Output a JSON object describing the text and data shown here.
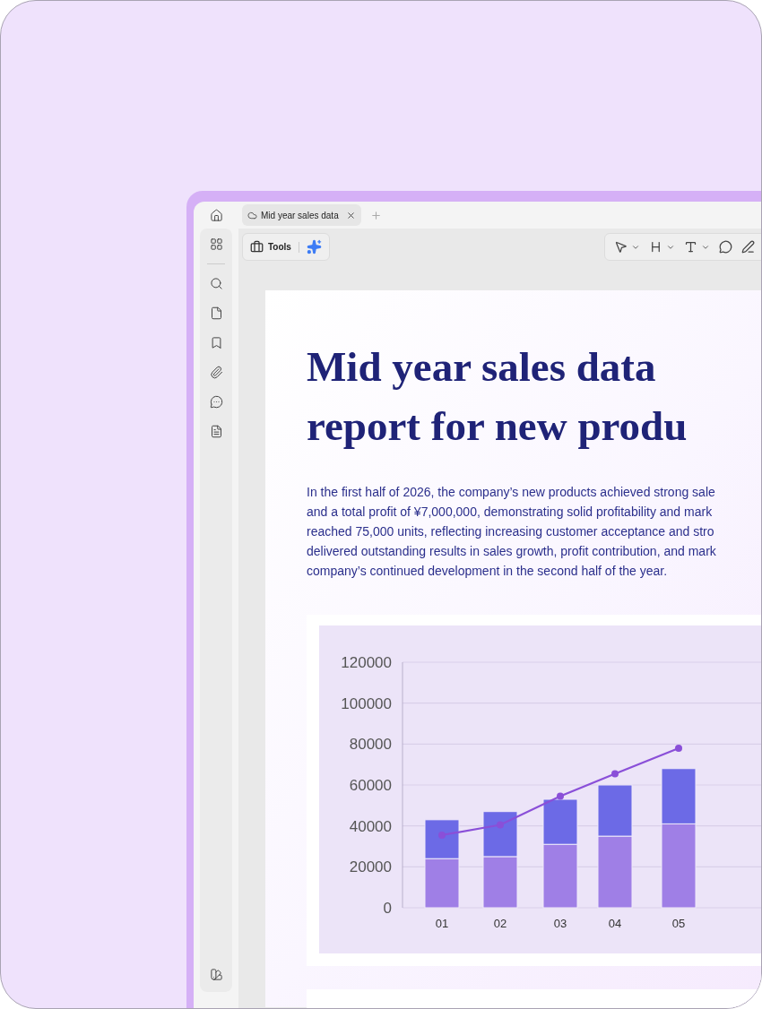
{
  "tabs": [
    {
      "label": "Mid year sales data",
      "selected": true
    }
  ],
  "toolbar": {
    "tools_label": "Tools"
  },
  "document": {
    "title_lines": [
      "Mid year sales data",
      "report for new produ"
    ],
    "paragraph_lines": [
      "In the first half of 2026, the company’s new products achieved strong sale",
      "and a total profit of ¥7,000,000, demonstrating solid profitability and mark",
      "reached 75,000 units, reflecting increasing customer acceptance and stro",
      "delivered outstanding results in sales growth, profit contribution, and mark",
      "company’s continued development in the second half of the year."
    ],
    "chart_data": {
      "type": "bar",
      "stacked": true,
      "categories": [
        "01",
        "02",
        "03",
        "04",
        "05"
      ],
      "series": [
        {
          "color": "#9f7fe6",
          "values": [
            24000,
            25000,
            31000,
            35000,
            41000
          ]
        },
        {
          "color": "#6c6ae6",
          "values": [
            19000,
            22000,
            22000,
            25000,
            27000
          ]
        },
        {
          "type": "line",
          "marker": true,
          "color": "#8a4fd8",
          "values": [
            35500,
            40500,
            54500,
            65500,
            78000
          ]
        }
      ],
      "grid": true,
      "ylim": [
        0,
        120000
      ],
      "yticks": [
        0,
        20000,
        40000,
        60000,
        80000,
        100000,
        120000
      ]
    }
  }
}
